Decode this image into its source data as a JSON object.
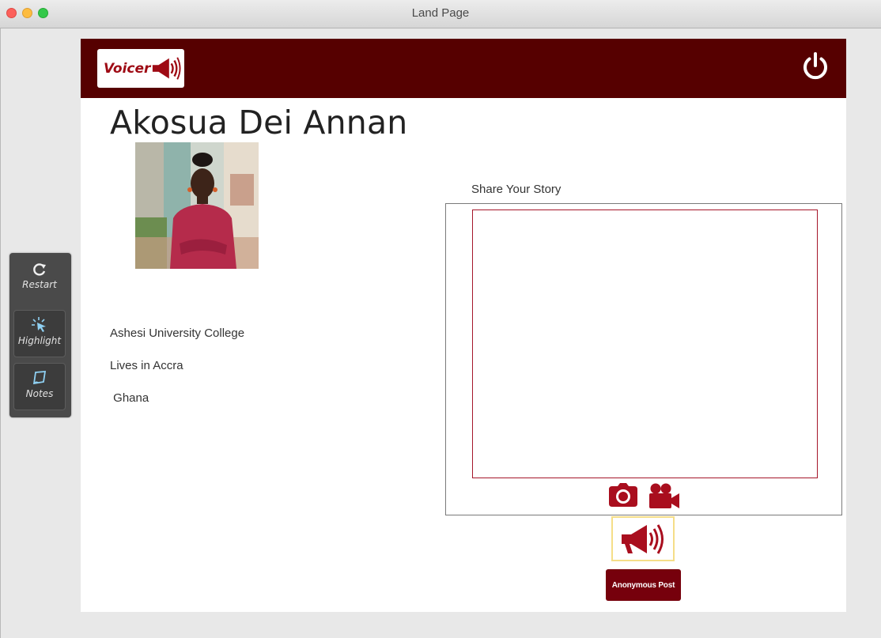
{
  "window": {
    "title": "Land Page"
  },
  "app": {
    "logo_text": "Voicer"
  },
  "profile": {
    "name": "Akosua Dei Annan",
    "school": "Ashesi University College",
    "city": "Lives in Accra",
    "country": " Ghana"
  },
  "story": {
    "label": "Share Your Story",
    "placeholder": ""
  },
  "actions": {
    "anonymous_post": "Anonymous Post"
  },
  "tools": [
    {
      "label": "Restart",
      "icon": "restart-icon"
    },
    {
      "label": "Highlight",
      "icon": "highlight-cursor-icon"
    },
    {
      "label": "Notes",
      "icon": "notes-icon"
    }
  ],
  "colors": {
    "brand_maroon": "#560000",
    "accent_red": "#9e0a14",
    "button_maroon": "#76000c",
    "highlight_border": "#f5de88"
  }
}
